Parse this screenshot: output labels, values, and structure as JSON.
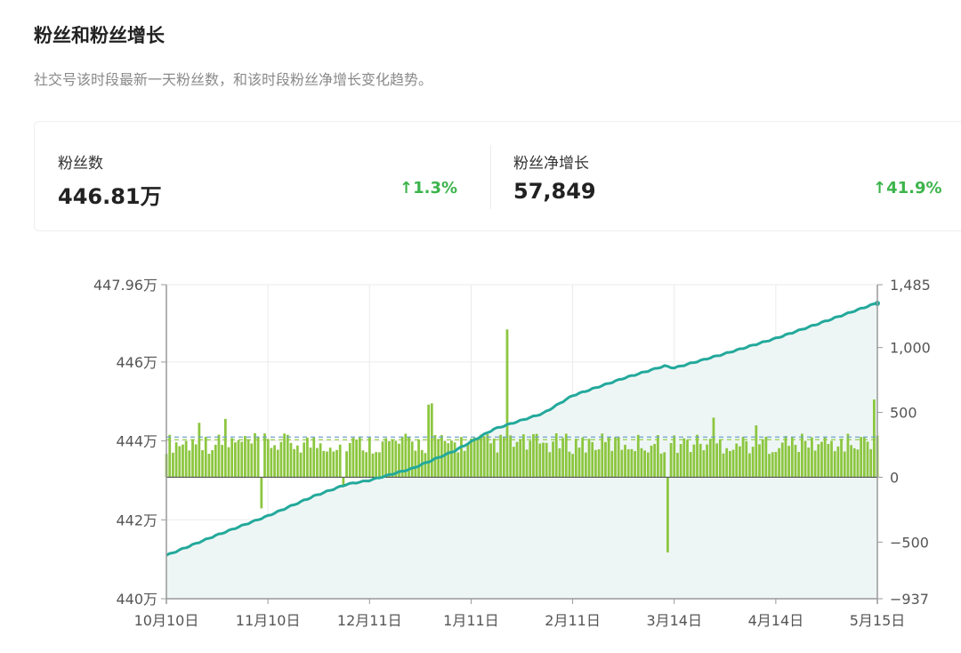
{
  "header": {
    "title": "粉丝和粉丝增长",
    "subtitle": "社交号该时段最新一天粉丝数，和该时段粉丝净增长变化趋势。"
  },
  "stats": [
    {
      "label": "粉丝数",
      "value": "446.81万",
      "change": "↑1.3%"
    },
    {
      "label": "粉丝净增长",
      "value": "57,849",
      "change": "↑41.9%"
    }
  ],
  "colors": {
    "line": "#23a99b",
    "area": "#eef6f5",
    "bar": "#8cc63f",
    "bar_edge": "#ffffff",
    "grid": "#ebebeb",
    "axis": "#999999",
    "up": "#3cb44b"
  },
  "chart_data": {
    "type": "bar+line",
    "x_ticks": [
      "10月10日",
      "11月10日",
      "12月11日",
      "1月11日",
      "2月11日",
      "3月14日",
      "4月14日",
      "5月15日"
    ],
    "x_tick_day_index": [
      0,
      31,
      62,
      93,
      124,
      155,
      186,
      217
    ],
    "n_days": 218,
    "y_left": {
      "ticks": [
        "447.96万",
        "446万",
        "444万",
        "442万",
        "440万"
      ],
      "tick_values": [
        447.96,
        446,
        444,
        442,
        440
      ],
      "range": [
        440,
        447.96
      ],
      "unit": "万"
    },
    "y_right": {
      "ticks": [
        "1,485",
        "1,000",
        "500",
        "0",
        "−500",
        "−937"
      ],
      "tick_values": [
        1485,
        1000,
        500,
        0,
        -500,
        -937
      ],
      "range": [
        -937,
        1485
      ]
    },
    "followers_line": {
      "name": "粉丝数",
      "axis": "left",
      "points": [
        [
          0,
          441.1
        ],
        [
          15,
          441.6
        ],
        [
          31,
          442.1
        ],
        [
          45,
          442.6
        ],
        [
          55,
          442.9
        ],
        [
          62,
          443.0
        ],
        [
          75,
          443.3
        ],
        [
          88,
          443.75
        ],
        [
          100,
          444.3
        ],
        [
          115,
          444.7
        ],
        [
          124,
          445.15
        ],
        [
          140,
          445.6
        ],
        [
          152,
          445.9
        ],
        [
          155,
          445.85
        ],
        [
          170,
          446.2
        ],
        [
          186,
          446.6
        ],
        [
          200,
          447.0
        ],
        [
          217,
          447.5
        ]
      ]
    },
    "net_growth_bars": {
      "name": "粉丝净增长",
      "axis": "right",
      "typical_range": [
        180,
        340
      ],
      "spikes": [
        [
          10,
          420
        ],
        [
          18,
          450
        ],
        [
          29,
          -240
        ],
        [
          54,
          -70
        ],
        [
          80,
          560
        ],
        [
          81,
          570
        ],
        [
          104,
          1140
        ],
        [
          153,
          -580
        ],
        [
          167,
          460
        ],
        [
          180,
          400
        ],
        [
          216,
          600
        ]
      ],
      "reference_lines": [
        290,
        310
      ]
    }
  }
}
